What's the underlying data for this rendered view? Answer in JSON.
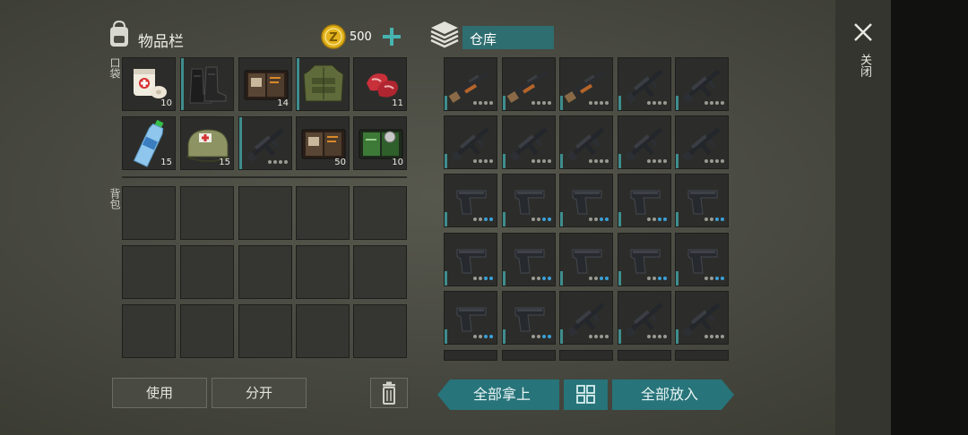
{
  "inventory": {
    "title": "物品栏",
    "coins": "500",
    "pocket_label": "口袋",
    "backpack_label": "背包",
    "pocket_items": [
      {
        "name": "bandage-item",
        "icon": "medkit-bandage-icon",
        "qty": "10"
      },
      {
        "name": "boots-item",
        "icon": "boots-icon",
        "qty": ""
      },
      {
        "name": "recipe-book-item",
        "icon": "recipe-book-icon",
        "qty": "14"
      },
      {
        "name": "armor-vest-item",
        "icon": "armor-vest-icon",
        "qty": ""
      },
      {
        "name": "raw-meat-item",
        "icon": "raw-meat-icon",
        "qty": "11"
      },
      {
        "name": "water-bottle-item",
        "icon": "water-bottle-icon",
        "qty": "15"
      },
      {
        "name": "first-aid-bag-item",
        "icon": "first-aid-bag-icon",
        "qty": "15"
      },
      {
        "name": "assault-rifle-item",
        "icon": "assault-rifle-icon",
        "qty": ""
      },
      {
        "name": "recipe-book-item-2",
        "icon": "recipe-book-icon",
        "qty": "50"
      },
      {
        "name": "green-book-item",
        "icon": "green-book-icon",
        "qty": "10"
      }
    ]
  },
  "storage": {
    "title": "仓库"
  },
  "buttons": {
    "use": "使用",
    "split": "分开",
    "take_all": "全部拿上",
    "put_all": "全部放入",
    "close": "关闭"
  },
  "colors": {
    "accent_teal": "#3f8d8e",
    "button_teal": "#27747a",
    "coin_gold": "#e3b21c"
  }
}
